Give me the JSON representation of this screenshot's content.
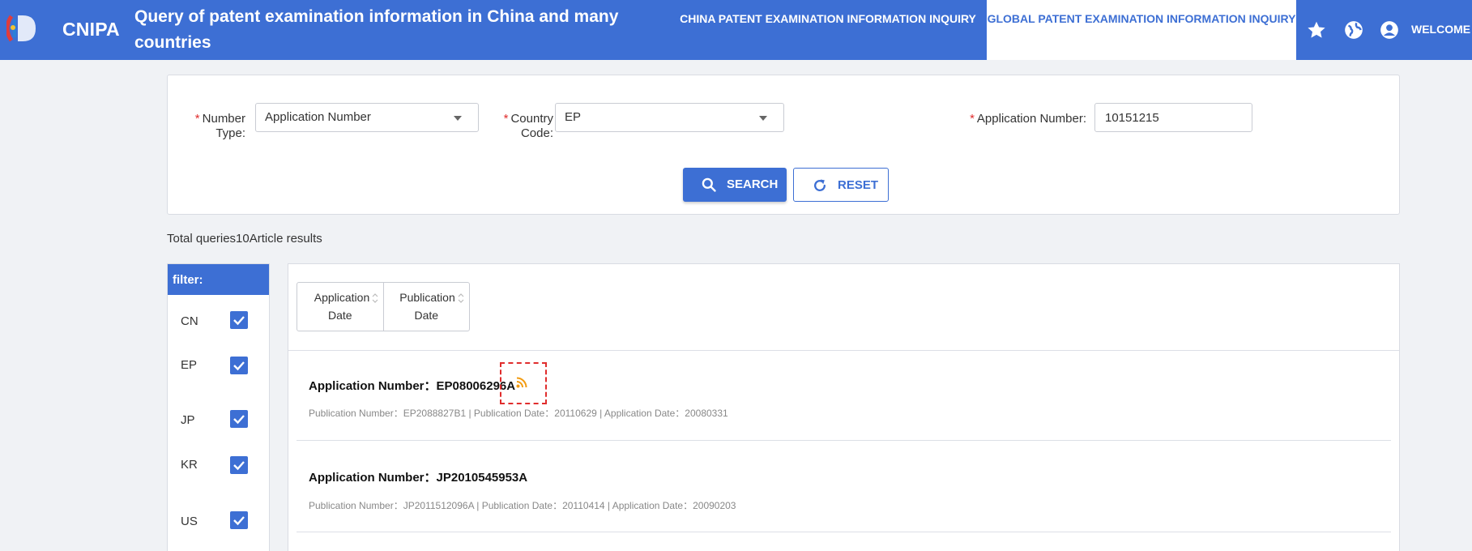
{
  "header": {
    "brand": "CNIPA",
    "title": "Query of patent examination information in China and many countries",
    "nav_cn": "CHINA PATENT EXAMINATION INFORMATION INQUIRY",
    "nav_global": "GLOBAL PATENT EXAMINATION INFORMATION INQUIRY",
    "welcome": "WELCOME",
    "icons": [
      "star-icon",
      "globe-icon",
      "user-icon"
    ]
  },
  "search": {
    "number_type_label": "Number Type:",
    "number_type_value": "Application Number",
    "country_code_label": "Country Code:",
    "country_code_value": "EP",
    "app_number_label": "Application Number:",
    "app_number_value": "10151215",
    "required_mark": "*",
    "search_label": "SEARCH",
    "reset_label": "RESET"
  },
  "total_text": "Total queries10Article results",
  "filter": {
    "title": "filter:",
    "items": [
      {
        "code": "CN",
        "checked": true
      },
      {
        "code": "EP",
        "checked": true
      },
      {
        "code": "JP",
        "checked": true
      },
      {
        "code": "KR",
        "checked": true
      },
      {
        "code": "US",
        "checked": true
      }
    ]
  },
  "sort": {
    "application_date": "Application Date",
    "publication_date": "Publication Date"
  },
  "results": [
    {
      "title": "Application Number：EP08006296A",
      "meta": "Publication Number：EP2088827B1 |  Publication Date：20110629 |  Application Date：20080331"
    },
    {
      "title": "Application Number：JP2010545953A",
      "meta": "Publication Number：JP2011512096A |  Publication Date：20110414 |  Application Date：20090203"
    }
  ],
  "colors": {
    "primary": "#3d6fd4",
    "required": "#e02d2d",
    "rss": "#f39c12"
  }
}
